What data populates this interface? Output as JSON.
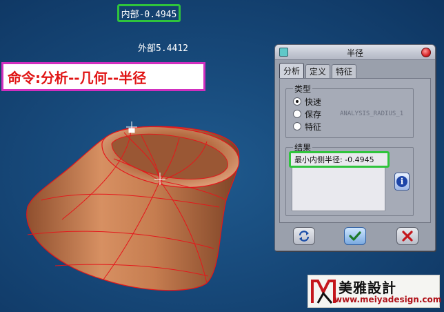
{
  "viewport": {
    "inner_measure": "内部-0.4945",
    "outer_measure": "外部5.4412",
    "command_banner": "命令:分析--几何--半径"
  },
  "dialog": {
    "title": "半径",
    "tabs": [
      {
        "label": "分析",
        "active": true
      },
      {
        "label": "定义",
        "active": false
      },
      {
        "label": "特征",
        "active": false
      }
    ],
    "type_group": {
      "title": "类型",
      "options": [
        {
          "label": "快速",
          "checked": true
        },
        {
          "label": "保存",
          "checked": false
        },
        {
          "label": "特征",
          "checked": false
        }
      ],
      "feature_name": "ANALYSIS_RADIUS_1"
    },
    "result_group": {
      "title": "结果",
      "result_text": "最小内侧半径: -0.4945"
    },
    "info_glyph": "i",
    "buttons": [
      "repeat-icon",
      "ok-icon",
      "cancel-icon"
    ]
  },
  "watermark": {
    "name": "美雅設計",
    "url": "www.meiyadesign.com"
  },
  "colors": {
    "highlight_green": "#2fc43c",
    "banner_border": "#d12fbf",
    "banner_text": "#e01414",
    "model_surface": "#c17a4f",
    "model_edges": "#e4171b"
  }
}
